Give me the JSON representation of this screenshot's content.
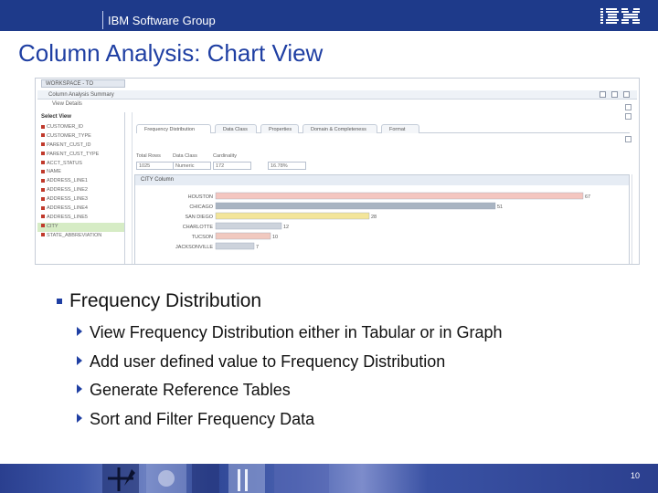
{
  "header": {
    "group_label": "IBM Software Group",
    "logo_text": "IBM",
    "colors": {
      "bar": "#1e3a8a",
      "title": "#1f3fa3"
    }
  },
  "title": "Column Analysis: Chart View",
  "screenshot": {
    "tab_label": "WORKSPACE - TO",
    "title": "Column Analysis Summary",
    "subtitle": "View Details",
    "select_view_label": "Select View",
    "columns": [
      "CUSTOMER_ID",
      "CUSTOMER_TYPE",
      "PARENT_CUST_ID",
      "PARENT_CUST_TYPE",
      "ACCT_STATUS",
      "NAME",
      "ADDRESS_LINE1",
      "ADDRESS_LINE2",
      "ADDRESS_LINE3",
      "ADDRESS_LINE4",
      "ADDRESS_LINE5",
      "CITY",
      "STATE_ABBREVIATION"
    ],
    "selected_column": "CITY",
    "inner_tabs": [
      "Frequency Distribution",
      "Data Class",
      "Properties",
      "Domain & Completeness",
      "Format"
    ],
    "stats": [
      {
        "label": "Total Rows",
        "value": "1025"
      },
      {
        "label": "Data Class",
        "value": "Numeric"
      },
      {
        "label": "Cardinality",
        "value": "172"
      },
      {
        "label": "",
        "value": "16.78%"
      }
    ],
    "chart_title": "CITY Column"
  },
  "chart_data": {
    "type": "bar",
    "orientation": "horizontal",
    "title": "CITY Column",
    "categories": [
      "HOUSTON",
      "CHICAGO",
      "SAN DIEGO",
      "CHARLOTTE",
      "TUCSON",
      "JACKSONVILLE"
    ],
    "values": [
      67,
      51,
      28,
      12,
      10,
      7
    ],
    "xlim": [
      0,
      70
    ],
    "colors": [
      "#f4c6c0",
      "#a9b4c2",
      "#f3e59a",
      "#cdd3dc",
      "#f1c9bf",
      "#cdd3dc"
    ],
    "grid": false
  },
  "bullets": {
    "main": "Frequency Distribution",
    "sub": [
      "View Frequency Distribution either in Tabular or in Graph",
      "Add user defined value to Frequency Distribution",
      "Generate Reference Tables",
      "Sort and Filter Frequency Data"
    ]
  },
  "footer": {
    "page_number": "10"
  }
}
